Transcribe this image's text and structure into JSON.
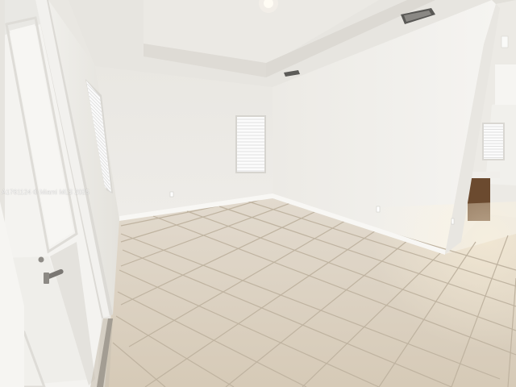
{
  "photo": {
    "watermark": "A1761124 © Miami MLS 2025"
  },
  "colors": {
    "wall_back": "#eeece8",
    "wall_right": "#f2f1ee",
    "ceiling": "#e6e4df",
    "floor": "#dcd2c2",
    "grout": "#b9ad9a",
    "door": "#f4f3f0",
    "door_frame": "#ecebe7",
    "trim": "#f7f6f3",
    "window_light": "#fbfbfb",
    "cabinet": "#6b4a2f"
  },
  "icons": [
    "ceiling-light-icon",
    "air-vent-icon",
    "door-handle-icon",
    "window-blinds-icon",
    "power-outlet-icon"
  ]
}
